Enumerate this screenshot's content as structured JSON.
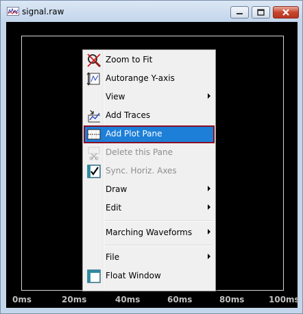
{
  "window": {
    "title": "signal.raw",
    "icon": "waveform-icon",
    "controls": [
      "minimize-icon",
      "maximize-icon",
      "close-icon"
    ]
  },
  "plot": {
    "background": "#000000",
    "x_ticks": [
      "0ms",
      "20ms",
      "40ms",
      "60ms",
      "80ms",
      "100ms"
    ]
  },
  "context_menu": {
    "items": [
      {
        "label": "Zoom to Fit",
        "icon": "zoom-to-fit-icon",
        "enabled": true
      },
      {
        "label": "Autorange Y-axis",
        "icon": "autorange-y-axis-icon",
        "enabled": true
      },
      {
        "label": "View",
        "submenu": true,
        "enabled": true
      },
      {
        "label": "Add Traces",
        "icon": "add-traces-icon",
        "enabled": true
      },
      {
        "label": "Add Plot Pane",
        "icon": "add-plot-pane-icon",
        "enabled": true,
        "highlighted": true
      },
      {
        "label": "Delete this Pane",
        "icon": "delete-pane-icon",
        "enabled": false
      },
      {
        "label": "Sync. Horiz. Axes",
        "icon": "checkmark-icon",
        "enabled": false,
        "checked": true
      },
      {
        "label": "Draw",
        "submenu": true,
        "enabled": true
      },
      {
        "label": "Edit",
        "submenu": true,
        "enabled": true
      },
      {
        "label": "Marching Waveforms",
        "submenu": true,
        "enabled": true
      },
      {
        "label": "File",
        "submenu": true,
        "enabled": true
      },
      {
        "label": "Float Window",
        "icon": "float-window-icon",
        "enabled": true
      }
    ]
  },
  "colors": {
    "highlight": "#1d7fd8",
    "highlight_border": "#8b0d22",
    "tick_text": "#c0c0c0"
  }
}
